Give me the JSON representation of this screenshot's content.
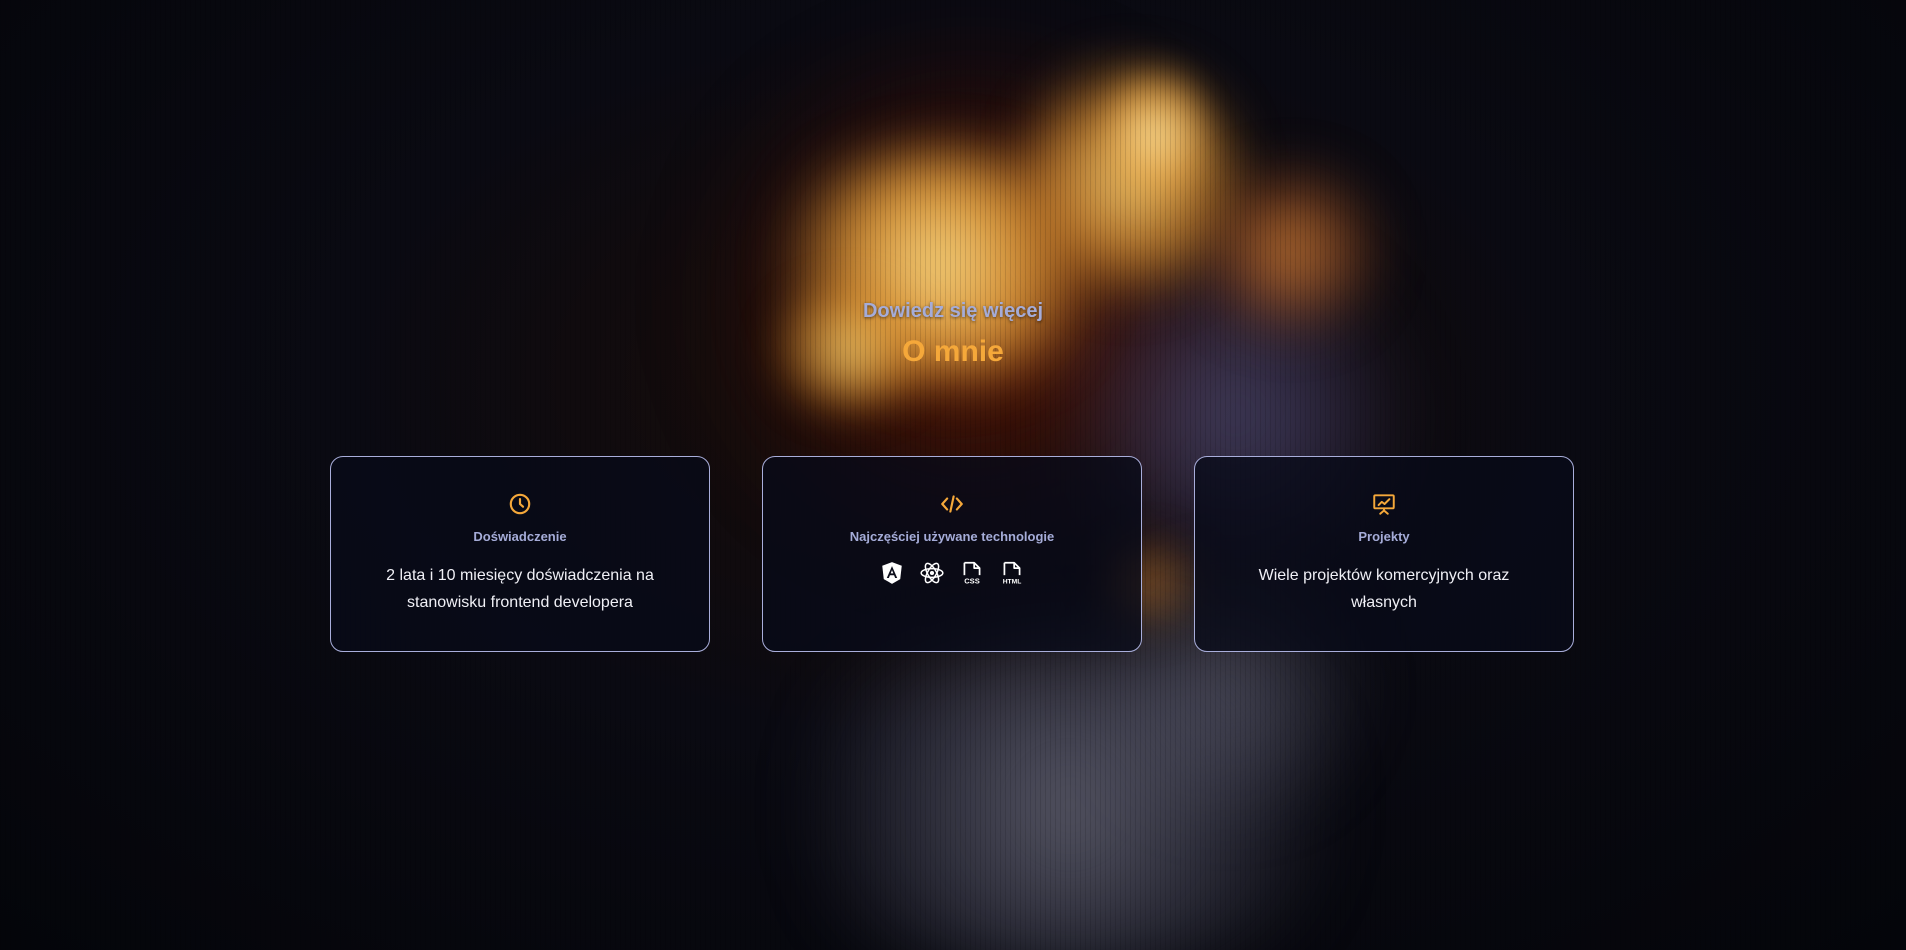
{
  "header": {
    "eyebrow": "Dowiedz się więcej",
    "title": "O mnie"
  },
  "cards": [
    {
      "icon": "clock-icon",
      "title": "Doświadczenie",
      "text": "2 lata i 10 miesięcy doświadczenia na stanowisku frontend developera"
    },
    {
      "icon": "code-icon",
      "title": "Najczęściej używane technologie",
      "technologies": [
        "angular-icon",
        "react-icon",
        "css-file-icon",
        "html-file-icon"
      ]
    },
    {
      "icon": "presentation-chart-icon",
      "title": "Projekty",
      "text": "Wiele projektów komercyjnych oraz własnych"
    }
  ],
  "colors": {
    "accent": "#f5a83a",
    "muted_text": "#a5acd8",
    "card_border": "#a9aedb",
    "background": "#05060c"
  }
}
